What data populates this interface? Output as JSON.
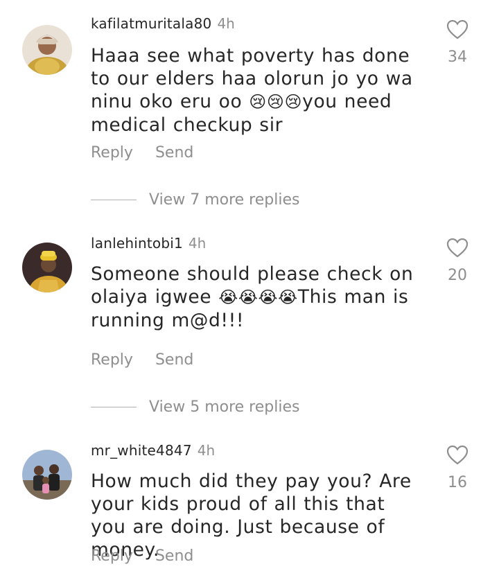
{
  "comments": [
    {
      "username": "kafilatmuritala80",
      "time": "4h",
      "text_parts": [
        "Haaa see what poverty has done to our elders  haa olorun jo yo wa ninu oko eru oo ",
        "😢😢😢",
        "you need medical checkup sir"
      ],
      "likes": "34",
      "reply_label": "Reply",
      "send_label": "Send",
      "view_replies": "View 7 more replies",
      "avatar_icon": "profile-photo-woman-gold-outfit"
    },
    {
      "username": "lanlehintobi1",
      "time": "4h",
      "text_parts": [
        "Someone should please check on olaiya igwee ",
        "😭😭😭😭",
        "This man is running m@d!!!"
      ],
      "likes": "20",
      "reply_label": "Reply",
      "send_label": "Send",
      "view_replies": "View 5 more replies",
      "avatar_icon": "profile-photo-man-yellow-cap"
    },
    {
      "username": "mr_white4847",
      "time": "4h",
      "text_parts": [
        "How much did they pay you?  Are your kids proud of all this that you are doing. Just because of money.",
        "",
        ""
      ],
      "likes": "16",
      "reply_label": "Reply",
      "send_label": "Send",
      "avatar_icon": "profile-photo-family-outdoor"
    }
  ],
  "icons": {
    "like": "heart-outline-icon"
  },
  "colors": {
    "text": "#262626",
    "muted": "#8e8e8e",
    "divider": "#b0b0b0"
  }
}
